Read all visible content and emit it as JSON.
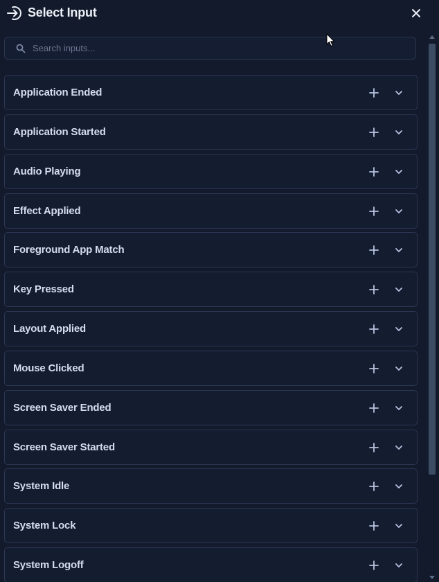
{
  "header": {
    "title": "Select Input"
  },
  "search": {
    "placeholder": "Search inputs...",
    "value": ""
  },
  "items": [
    {
      "label": "Application Ended"
    },
    {
      "label": "Application Started"
    },
    {
      "label": "Audio Playing"
    },
    {
      "label": "Effect Applied"
    },
    {
      "label": "Foreground App Match"
    },
    {
      "label": "Key Pressed"
    },
    {
      "label": "Layout Applied"
    },
    {
      "label": "Mouse Clicked"
    },
    {
      "label": "Screen Saver Ended"
    },
    {
      "label": "Screen Saver Started"
    },
    {
      "label": "System Idle"
    },
    {
      "label": "System Lock"
    },
    {
      "label": "System Logoff"
    }
  ],
  "icons": {
    "title": "login-arrow-icon",
    "close": "close-icon",
    "search": "search-icon",
    "add": "plus-icon",
    "expand": "chevron-down-icon"
  },
  "colors": {
    "background": "#121a2c",
    "item_background": "#141c30",
    "item_border": "#2b3652",
    "text": "#d5dcef",
    "icon": "#b8c3e0",
    "scroll_thumb": "#3b4c63"
  }
}
